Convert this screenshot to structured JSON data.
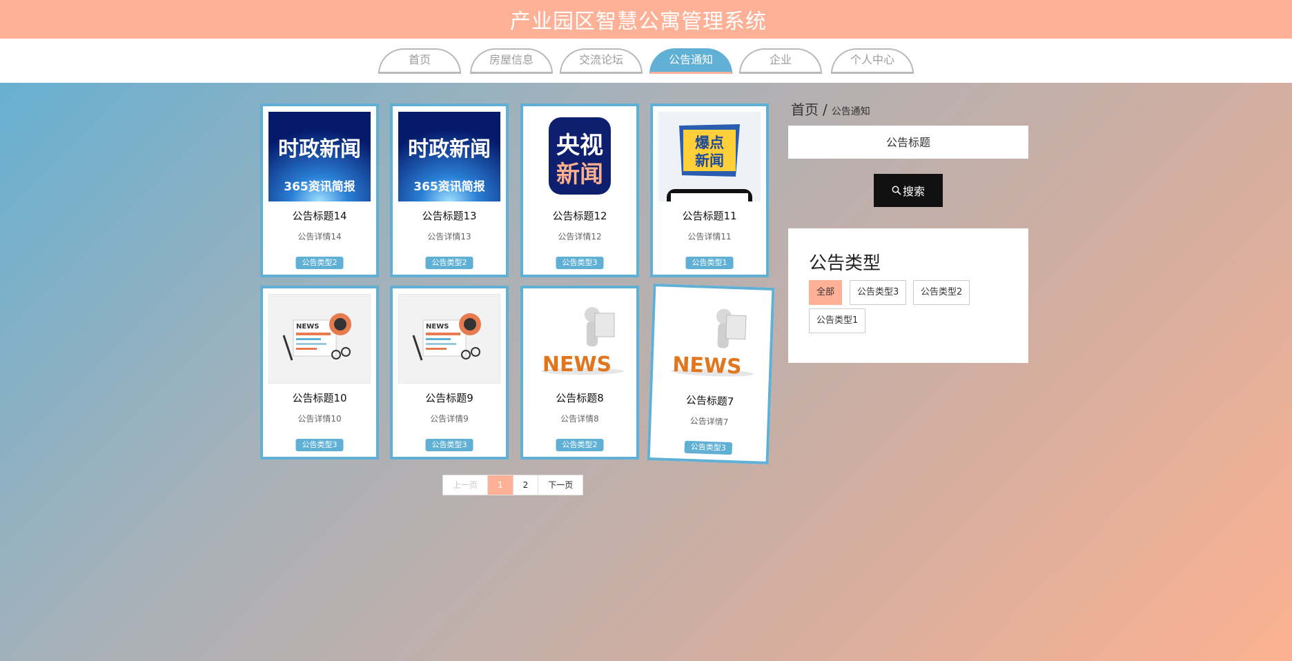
{
  "header": {
    "title": "产业园区智慧公寓管理系统"
  },
  "nav": {
    "items": [
      {
        "label": "首页"
      },
      {
        "label": "房屋信息"
      },
      {
        "label": "交流论坛"
      },
      {
        "label": "公告通知",
        "active": true
      },
      {
        "label": "企业"
      },
      {
        "label": "个人中心"
      }
    ]
  },
  "cards": [
    {
      "title": "公告标题14",
      "detail": "公告详情14",
      "type": "公告类型2",
      "image": "时政新闻 365资讯简报"
    },
    {
      "title": "公告标题13",
      "detail": "公告详情13",
      "type": "公告类型2",
      "image": "时政新闻 365资讯简报"
    },
    {
      "title": "公告标题12",
      "detail": "公告详情12",
      "type": "公告类型3",
      "image": "央视新闻"
    },
    {
      "title": "公告标题11",
      "detail": "公告详情11",
      "type": "公告类型1",
      "image": "爆点新闻"
    },
    {
      "title": "公告标题10",
      "detail": "公告详情10",
      "type": "公告类型3",
      "image": "NEWS"
    },
    {
      "title": "公告标题9",
      "detail": "公告详情9",
      "type": "公告类型3",
      "image": "NEWS"
    },
    {
      "title": "公告标题8",
      "detail": "公告详情8",
      "type": "公告类型2",
      "image": "NEWS"
    },
    {
      "title": "公告标题7",
      "detail": "公告详情7",
      "type": "公告类型3",
      "image": "NEWS"
    }
  ],
  "pagination": {
    "prev": "上一页",
    "pages": [
      "1",
      "2"
    ],
    "current": "1",
    "next": "下一页"
  },
  "breadcrumb": {
    "home": "首页",
    "separator": "/",
    "current": "公告通知"
  },
  "search": {
    "placeholder": "公告标题",
    "button_label": "搜索",
    "icon": "search-icon"
  },
  "type_filter": {
    "title": "公告类型",
    "options": [
      "全部",
      "公告类型3",
      "公告类型2",
      "公告类型1"
    ],
    "selected": "全部"
  },
  "colors": {
    "primary": "#5fb0d4",
    "accent": "#feb197",
    "dark": "#111111"
  }
}
